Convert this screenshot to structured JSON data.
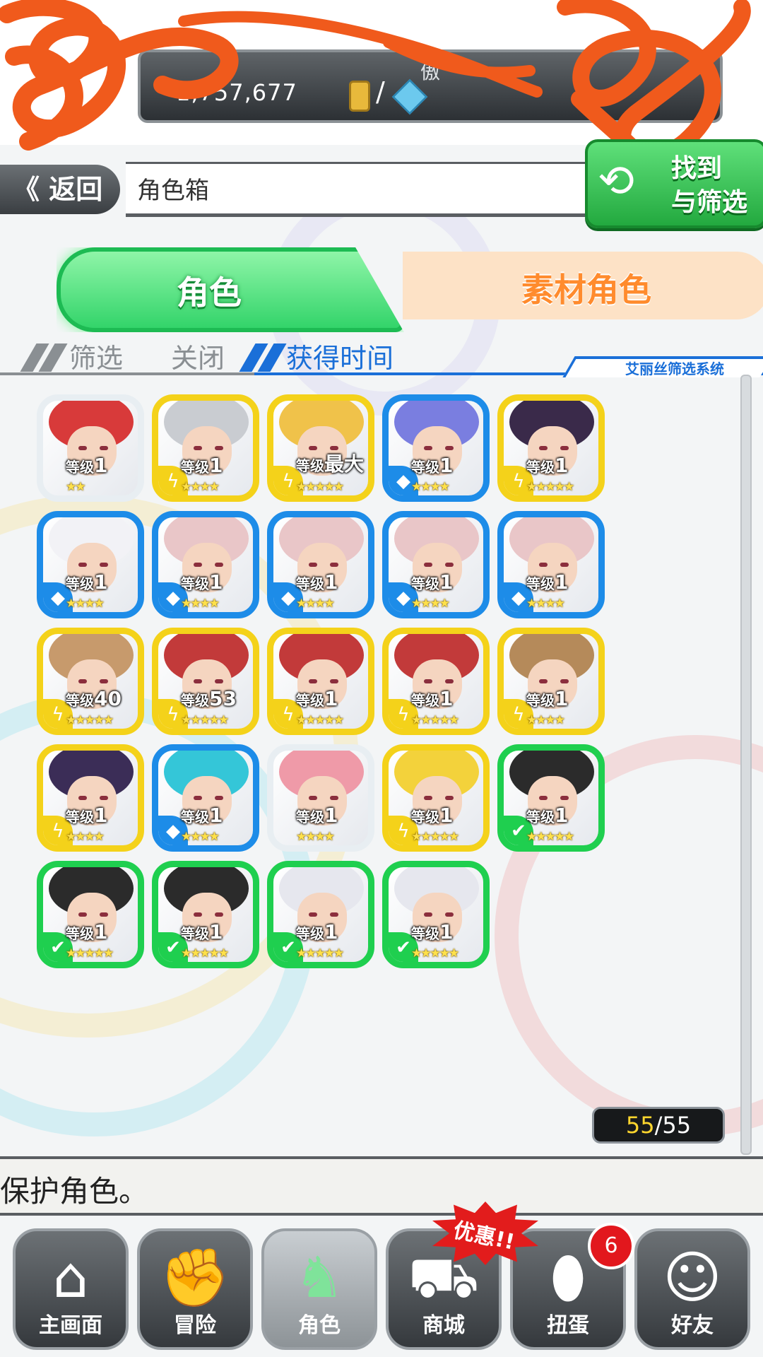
{
  "resources": {
    "label": "傲",
    "gold": "1,757,677",
    "separator": "/"
  },
  "header": {
    "back_label": "《 返回",
    "title": "角色箱",
    "sort_line1": "找到",
    "sort_line2": "与筛选"
  },
  "tabs": {
    "characters": "角色",
    "materials": "素材角色"
  },
  "filter": {
    "filter_label": "筛选",
    "state_label": "关闭",
    "sort_label": "获得时间",
    "system_label": "艾丽丝筛选系统"
  },
  "grid": {
    "cards": [
      {
        "level_prefix": "等级",
        "level": "1",
        "stars": "★★",
        "element": "none",
        "border": "#e8eef2",
        "hair": "#d83a3a"
      },
      {
        "level_prefix": "等级",
        "level": "1",
        "stars": "★★★★",
        "element": "thunder",
        "border": "#f4d21a",
        "hair": "#c9ccd1"
      },
      {
        "level_prefix": "等级",
        "level": "最大",
        "stars": "★★★★★",
        "element": "thunder",
        "border": "#f4d21a",
        "hair": "#f0c24a"
      },
      {
        "level_prefix": "等级",
        "level": "1",
        "stars": "★★★★",
        "element": "water",
        "border": "#1d8ce8",
        "hair": "#7a7ee0"
      },
      {
        "level_prefix": "等级",
        "level": "1",
        "stars": "★★★★★",
        "element": "thunder",
        "border": "#f4d21a",
        "hair": "#3a2a4a"
      },
      {
        "level_prefix": "等级",
        "level": "1",
        "stars": "★★★★",
        "element": "water",
        "border": "#1d8ce8",
        "hair": "#f2f2f6"
      },
      {
        "level_prefix": "等级",
        "level": "1",
        "stars": "★★★★",
        "element": "water",
        "border": "#1d8ce8",
        "hair": "#e9c6c8"
      },
      {
        "level_prefix": "等级",
        "level": "1",
        "stars": "★★★★",
        "element": "water",
        "border": "#1d8ce8",
        "hair": "#e9c6c8"
      },
      {
        "level_prefix": "等级",
        "level": "1",
        "stars": "★★★★",
        "element": "water",
        "border": "#1d8ce8",
        "hair": "#e9c6c8"
      },
      {
        "level_prefix": "等级",
        "level": "1",
        "stars": "★★★★",
        "element": "water",
        "border": "#1d8ce8",
        "hair": "#e9c6c8"
      },
      {
        "level_prefix": "等级",
        "level": "40",
        "stars": "★★★★★",
        "element": "thunder",
        "border": "#f4d21a",
        "hair": "#c79a6c"
      },
      {
        "level_prefix": "等级",
        "level": "53",
        "stars": "★★★★★",
        "element": "thunder",
        "border": "#f4d21a",
        "hair": "#c23a3a"
      },
      {
        "level_prefix": "等级",
        "level": "1",
        "stars": "★★★★★",
        "element": "thunder",
        "border": "#f4d21a",
        "hair": "#c23a3a"
      },
      {
        "level_prefix": "等级",
        "level": "1",
        "stars": "★★★★★",
        "element": "thunder",
        "border": "#f4d21a",
        "hair": "#c23a3a"
      },
      {
        "level_prefix": "等级",
        "level": "1",
        "stars": "★★★★",
        "element": "thunder",
        "border": "#f4d21a",
        "hair": "#b58a5a"
      },
      {
        "level_prefix": "等级",
        "level": "1",
        "stars": "★★★★",
        "element": "thunder",
        "border": "#f4d21a",
        "hair": "#3b2d57"
      },
      {
        "level_prefix": "等级",
        "level": "1",
        "stars": "★★★★",
        "element": "water",
        "border": "#1d8ce8",
        "hair": "#34c6d8"
      },
      {
        "level_prefix": "等级",
        "level": "1",
        "stars": "★★★★",
        "element": "none",
        "border": "#e8eef2",
        "hair": "#ef9aa8"
      },
      {
        "level_prefix": "等级",
        "level": "1",
        "stars": "★★★★★",
        "element": "thunder",
        "border": "#f4d21a",
        "hair": "#f3d23b"
      },
      {
        "level_prefix": "等级",
        "level": "1",
        "stars": "★★★★★",
        "element": "wood",
        "border": "#1fcf4f",
        "hair": "#2b2b2b"
      },
      {
        "level_prefix": "等级",
        "level": "1",
        "stars": "★★★★★",
        "element": "wood",
        "border": "#1fcf4f",
        "hair": "#2b2b2b"
      },
      {
        "level_prefix": "等级",
        "level": "1",
        "stars": "★★★★★",
        "element": "wood",
        "border": "#1fcf4f",
        "hair": "#2b2b2b"
      },
      {
        "level_prefix": "等级",
        "level": "1",
        "stars": "★★★★★",
        "element": "wood",
        "border": "#1fcf4f",
        "hair": "#e6e7ee"
      },
      {
        "level_prefix": "等级",
        "level": "1",
        "stars": "★★★★★",
        "element": "wood",
        "border": "#1fcf4f",
        "hair": "#e6e7ee"
      }
    ]
  },
  "counter": {
    "current": "55",
    "sep": "/",
    "max": "55"
  },
  "message": "保护角色。",
  "nav": {
    "home": "主画面",
    "adventure": "冒险",
    "characters": "角色",
    "shop": "商城",
    "gacha": "扭蛋",
    "friends": "好友"
  },
  "badges": {
    "gacha_count": "6",
    "promo": "优惠!!"
  },
  "colors": {
    "thunder": "#f4d21a",
    "water": "#1d8ce8",
    "wood": "#1fcf4f",
    "accent_blue": "#1a6fd8",
    "tab_green": "#33d46a"
  },
  "icons": {
    "thunder": "thunder-element-icon",
    "water": "water-element-icon",
    "wood": "wood-element-icon"
  }
}
